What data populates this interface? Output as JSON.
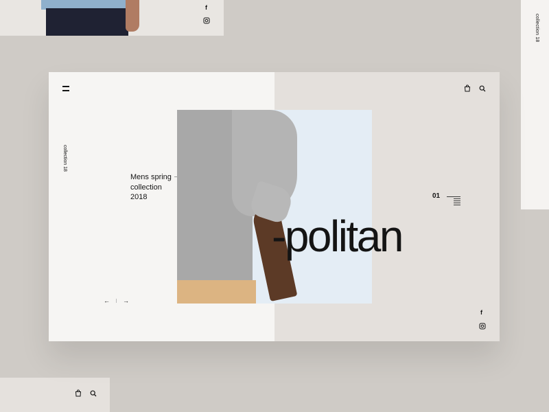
{
  "collection_label": "collection 18",
  "headline": {
    "line1": "Mens spring",
    "line2": "collection",
    "line3": "2018"
  },
  "hero_word": "-politan",
  "slide_number": "01",
  "social": {
    "facebook": "f"
  },
  "nav": {
    "prev": "←",
    "next": "→"
  },
  "colors": {
    "left_panel": "#f6f5f3",
    "right_panel": "#e4e0dc",
    "photo_bg": "#e4edf5",
    "page_bg": "#cfcbc6"
  }
}
